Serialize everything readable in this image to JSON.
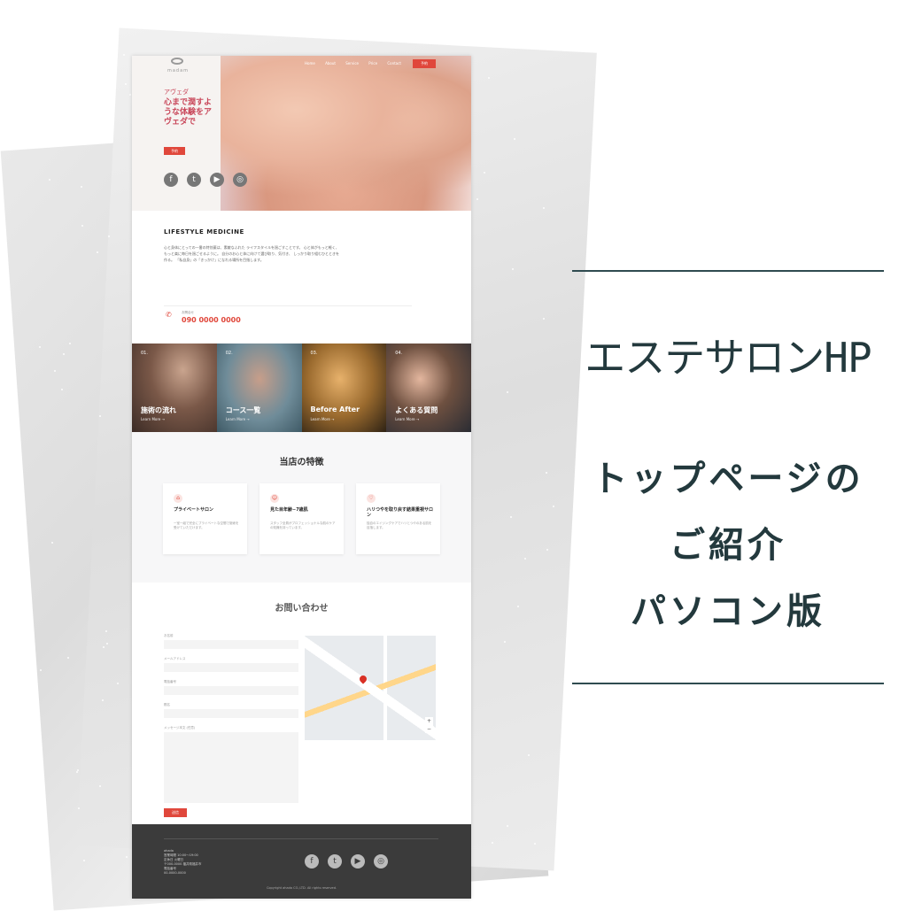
{
  "site": {
    "logo": "madam",
    "nav": [
      "Home",
      "About",
      "Service",
      "Price",
      "Contact"
    ],
    "nav_button": "予約",
    "hero": {
      "eyebrow": "アヴェダ",
      "title": "心まで潤すような体験をアヴェダで",
      "button": "予約"
    },
    "social_icons": [
      "facebook-icon",
      "twitter-icon",
      "youtube-icon",
      "instagram-icon"
    ],
    "lifestyle": {
      "title": "LIFESTYLE MEDICINE",
      "text": "心と身体にとっての一番の特効薬は、素敵なふれた ライフスタイルを過ごすことです。 心と体がもっと軽く、もっと楽に毎日を過ごせるように。 自分のお心と体に向けて選び取り、気付き、 しっかり取り組むひとときを作る。 「私自身」の「きっかけ」になれる場所を目指します。",
      "phone_label": "お問合せ",
      "phone": "090 0000 0000"
    },
    "tiles": [
      {
        "num": "01.",
        "label": "施術の流れ",
        "more": "Learn More →"
      },
      {
        "num": "02.",
        "label": "コース一覧",
        "more": "Learn More →"
      },
      {
        "num": "03.",
        "label": "Before After",
        "more": "Learn More →"
      },
      {
        "num": "04.",
        "label": "よくある質問",
        "more": "Learn More →"
      }
    ],
    "features": {
      "title": "当店の特徴",
      "cards": [
        {
          "title": "プライベートサロン",
          "text": "一室一組で完全にプライベートな空間で施術を受けていただけます。"
        },
        {
          "title": "見た目年齢−7歳肌",
          "text": "スタッフ全員がプロフェッショナルな肌のケアの知識を持っています。"
        },
        {
          "title": "ハリつやを取り戻す結果重視サロン",
          "text": "独自のエイジングケアでハリとつやのある肌を目指します。"
        }
      ]
    },
    "contact": {
      "title": "お問い合わせ",
      "fields": [
        "お名前",
        "メールアドレス",
        "電話番号",
        "題名",
        "メッセージ本文 (任意)"
      ],
      "submit": "送信"
    },
    "footer": {
      "info": "ahada\n営業時間 10:00〜19:00\n定休日 火曜日\n〒000-0000 福井県福井市\n電話番号\n00-0000-0000",
      "copyright": "Copyright ahada CO.,LTD. All rights reserved."
    }
  },
  "panel": {
    "title": "エステサロンHP",
    "lines": [
      "トップページの",
      "ご紹介",
      "パソコン版"
    ]
  },
  "colors": {
    "accent": "#e0473b",
    "panel_text": "#23393d"
  }
}
